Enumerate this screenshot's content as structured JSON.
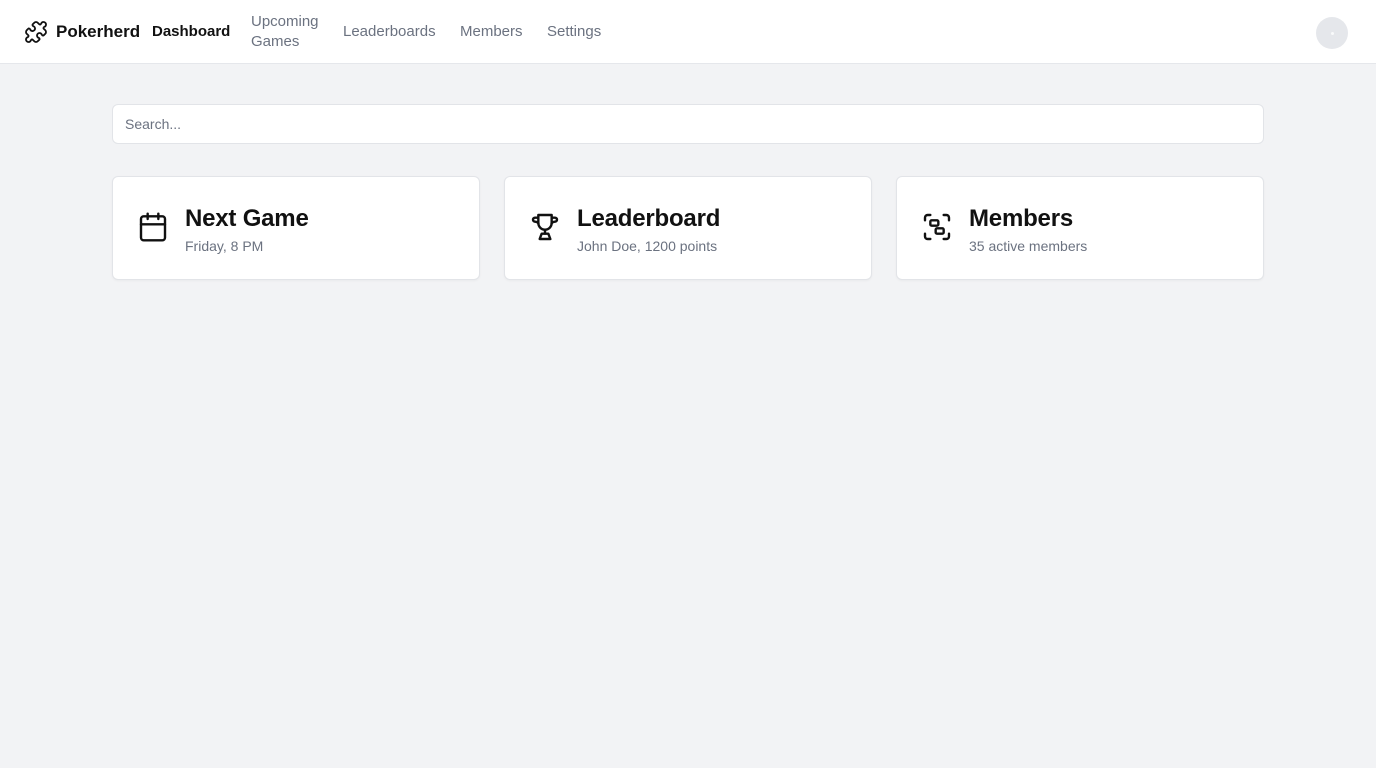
{
  "app": {
    "name": "Pokerherd",
    "logo_icon": "puzzle-icon"
  },
  "nav": {
    "items": [
      {
        "label": "Dashboard",
        "active": true
      },
      {
        "label": "Upcoming Games",
        "active": false
      },
      {
        "label": "Leaderboards",
        "active": false
      },
      {
        "label": "Members",
        "active": false
      },
      {
        "label": "Settings",
        "active": false
      }
    ]
  },
  "search": {
    "placeholder": "Search...",
    "value": ""
  },
  "cards": [
    {
      "title": "Next Game",
      "subtitle": "Friday, 8 PM",
      "icon": "calendar-icon"
    },
    {
      "title": "Leaderboard",
      "subtitle": "John Doe, 1200 points",
      "icon": "trophy-icon"
    },
    {
      "title": "Members",
      "subtitle": "35 active members",
      "icon": "scan-group-icon"
    }
  ],
  "colors": {
    "background": "#f2f3f5",
    "surface": "#ffffff",
    "text": "#111111",
    "muted": "#6b7280",
    "border": "#e2e4e8"
  }
}
